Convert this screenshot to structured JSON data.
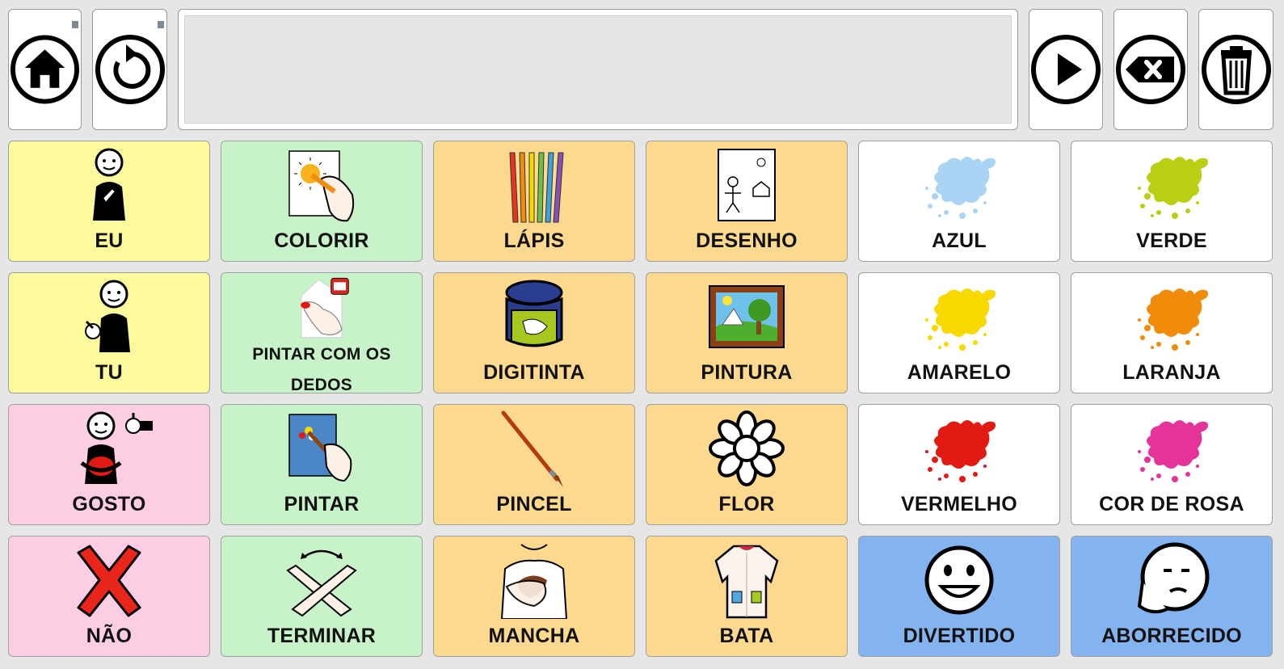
{
  "toolbar": {
    "home_icon": "home-icon",
    "back_icon": "undo-icon",
    "speak_icon": "play-icon",
    "backspace_icon": "backspace-icon",
    "clear_icon": "trash-icon"
  },
  "sentence_bar": {
    "text": ""
  },
  "colors": {
    "yellow": "#fcfa9c",
    "green": "#c8f3c8",
    "orange": "#fdd98f",
    "pink": "#fdcde3",
    "white": "#ffffff",
    "blue": "#84b4f0"
  },
  "cells": [
    {
      "label": "EU",
      "color": "#fcfa9c",
      "icon": "person-me-icon"
    },
    {
      "label": "COLORIR",
      "color": "#c8f3c8",
      "icon": "coloring-icon"
    },
    {
      "label": "LÁPIS",
      "color": "#fdd98f",
      "icon": "pencils-icon"
    },
    {
      "label": "DESENHO",
      "color": "#fdd98f",
      "icon": "drawing-icon"
    },
    {
      "label": "AZUL",
      "color": "#ffffff",
      "icon": "paint-splash-blue-icon",
      "splash": "#a9d4f3"
    },
    {
      "label": "VERDE",
      "color": "#ffffff",
      "icon": "paint-splash-green-icon",
      "splash": "#b9cf14"
    },
    {
      "label": "TU",
      "color": "#fcfa9c",
      "icon": "person-you-icon"
    },
    {
      "label": "PINTAR COM OS DEDOS",
      "color": "#c8f3c8",
      "icon": "finger-paint-icon"
    },
    {
      "label": "DIGITINTA",
      "color": "#fdd98f",
      "icon": "paint-jar-icon"
    },
    {
      "label": "PINTURA",
      "color": "#fdd98f",
      "icon": "painting-frame-icon"
    },
    {
      "label": "AMARELO",
      "color": "#ffffff",
      "icon": "paint-splash-yellow-icon",
      "splash": "#f7d900"
    },
    {
      "label": "LARANJA",
      "color": "#ffffff",
      "icon": "paint-splash-orange-icon",
      "splash": "#f08c0a"
    },
    {
      "label": "GOSTO",
      "color": "#fdcde3",
      "icon": "person-like-icon"
    },
    {
      "label": "PINTAR",
      "color": "#c8f3c8",
      "icon": "paint-brush-hand-icon"
    },
    {
      "label": "PINCEL",
      "color": "#fdd98f",
      "icon": "brush-icon"
    },
    {
      "label": "FLOR",
      "color": "#fdd98f",
      "icon": "flower-icon"
    },
    {
      "label": "VERMELHO",
      "color": "#ffffff",
      "icon": "paint-splash-red-icon",
      "splash": "#e11a14"
    },
    {
      "label": "COR DE ROSA",
      "color": "#ffffff",
      "icon": "paint-splash-pink-icon",
      "splash": "#e4349a"
    },
    {
      "label": "NÃO",
      "color": "#fdcde3",
      "icon": "cross-icon"
    },
    {
      "label": "TERMINAR",
      "color": "#c8f3c8",
      "icon": "crossed-arms-icon"
    },
    {
      "label": "MANCHA",
      "color": "#fdd98f",
      "icon": "stain-shirt-icon"
    },
    {
      "label": "BATA",
      "color": "#fdd98f",
      "icon": "smock-icon"
    },
    {
      "label": "DIVERTIDO",
      "color": "#84b4f0",
      "icon": "happy-face-icon"
    },
    {
      "label": "ABORRECIDO",
      "color": "#84b4f0",
      "icon": "bored-face-icon"
    }
  ]
}
